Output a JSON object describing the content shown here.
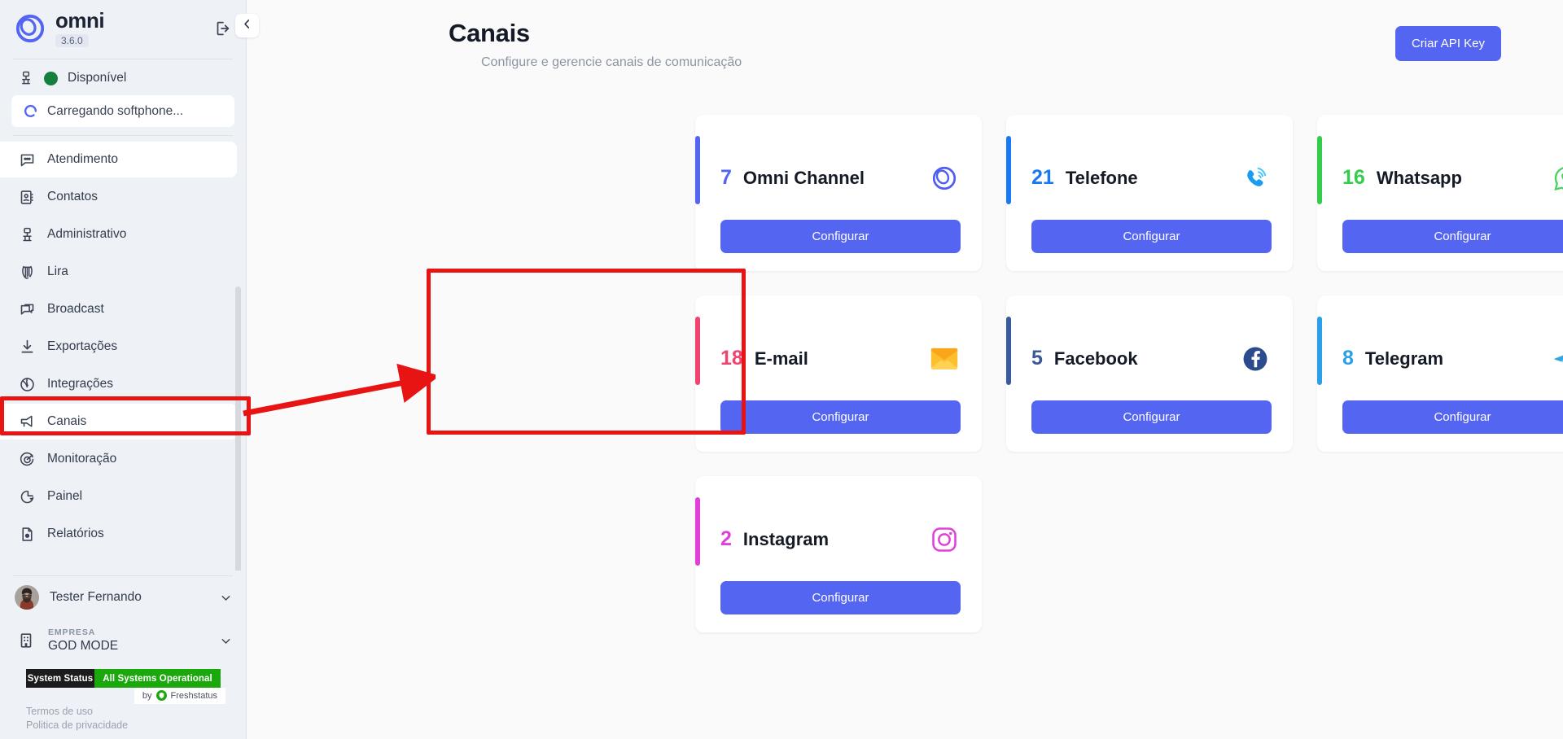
{
  "sidebar": {
    "brand": {
      "name": "omni",
      "version": "3.6.0",
      "logo_icon": "omni-logo-icon"
    },
    "logout_icon": "logout-icon",
    "collapse_icon": "chevron-left-icon",
    "agent_status": {
      "icon": "agent-desk-icon",
      "label": "Disponível",
      "dot_color": "#15803d"
    },
    "softphone": {
      "icon": "loading-spinner-icon",
      "label": "Carregando softphone..."
    },
    "nav_items": [
      {
        "label": "Atendimento",
        "icon": "chat-bubble-icon",
        "active": true
      },
      {
        "label": "Contatos",
        "icon": "contact-book-icon",
        "active": false
      },
      {
        "label": "Administrativo",
        "icon": "admin-desk-icon",
        "active": false
      },
      {
        "label": "Lira",
        "icon": "lyre-icon",
        "active": false
      },
      {
        "label": "Broadcast",
        "icon": "broadcast-chat-icon",
        "active": false
      },
      {
        "label": "Exportações",
        "icon": "download-icon",
        "active": false
      },
      {
        "label": "Integrações",
        "icon": "globe-icon",
        "active": false
      },
      {
        "label": "Canais",
        "icon": "megaphone-icon",
        "active": true
      },
      {
        "label": "Monitoração",
        "icon": "target-icon",
        "active": false
      },
      {
        "label": "Painel",
        "icon": "pie-chart-icon",
        "active": false
      },
      {
        "label": "Relatórios",
        "icon": "report-document-icon",
        "active": false
      }
    ],
    "user": {
      "name": "Tester Fernando",
      "avatar": "user-avatar",
      "chevron": "chevron-down-icon"
    },
    "company": {
      "kicker": "EMPRESA",
      "name": "GOD MODE",
      "icon": "building-icon",
      "chevron": "chevron-down-icon"
    },
    "system_status": {
      "left_label": "System Status",
      "right_label": "All Systems Operational",
      "by_prefix": "by",
      "by_brand": "Freshstatus",
      "left_bg": "#1c1c1c",
      "right_bg": "#1aa80c"
    },
    "legal_links": [
      "Termos de uso",
      "Politica de privacidade"
    ]
  },
  "header": {
    "title": "Canais",
    "subtitle": "Configure e gerencie canais de comunicação",
    "api_button": "Criar API Key"
  },
  "channels": [
    {
      "count": "7",
      "name": "Omni Channel",
      "icon": "omni-channel-icon",
      "accent": "#5465f2",
      "count_color": "#5465f2",
      "button": "Configurar",
      "highlighted": false
    },
    {
      "count": "21",
      "name": "Telefone",
      "icon": "phone-ringing-icon",
      "accent": "#1a78f0",
      "count_color": "#1a78f0",
      "button": "Configurar",
      "highlighted": false
    },
    {
      "count": "16",
      "name": "Whatsapp",
      "icon": "whatsapp-icon",
      "accent": "#35cc4b",
      "count_color": "#35cc4b",
      "button": "Configurar",
      "highlighted": false
    },
    {
      "count": "18",
      "name": "E-mail",
      "icon": "envelope-icon",
      "accent": "#ef4370",
      "count_color": "#ef4370",
      "button": "Configurar",
      "highlighted": true
    },
    {
      "count": "5",
      "name": "Facebook",
      "icon": "facebook-icon",
      "accent": "#3a5a9b",
      "count_color": "#3b5998",
      "button": "Configurar",
      "highlighted": false
    },
    {
      "count": "8",
      "name": "Telegram",
      "icon": "telegram-icon",
      "accent": "#2b9fe8",
      "count_color": "#2b9fe8",
      "button": "Configurar",
      "highlighted": false
    },
    {
      "count": "2",
      "name": "Instagram",
      "icon": "instagram-icon",
      "accent": "#e040d8",
      "count_color": "#e040d8",
      "button": "Configurar",
      "highlighted": false
    }
  ],
  "annotation": {
    "color": "#e81414",
    "highlighted_menu_item": "Canais",
    "highlighted_card": "E-mail"
  }
}
